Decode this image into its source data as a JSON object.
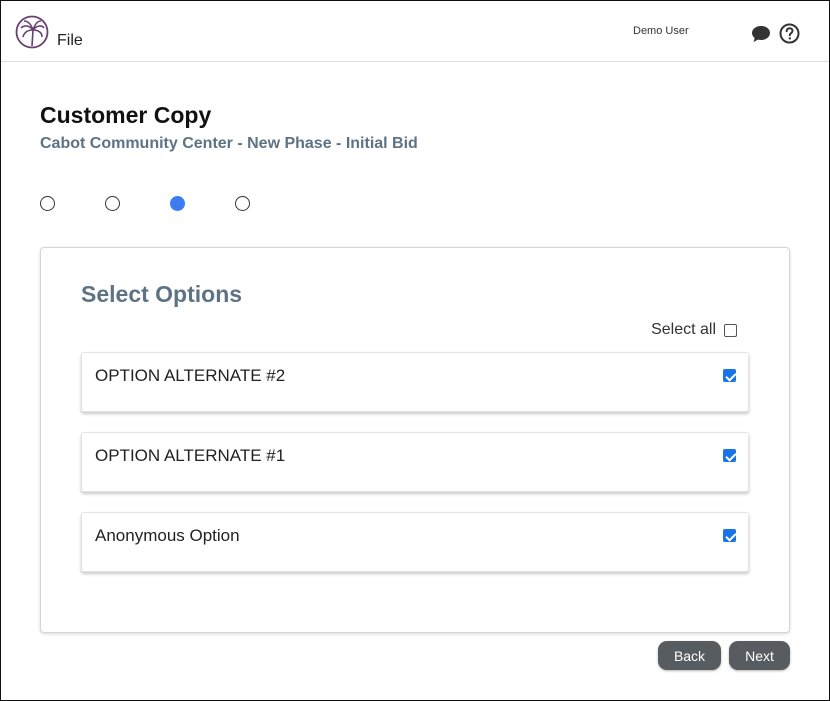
{
  "header": {
    "file_menu": "File",
    "user_name": "Demo User",
    "icons": {
      "logo": "palm-tree-logo",
      "chat": "chat-bubble-icon",
      "help": "help-circle-icon"
    }
  },
  "page": {
    "title": "Customer Copy",
    "subtitle": "Cabot Community Center - New Phase - Initial Bid"
  },
  "steps": {
    "count": 4,
    "active_index": 2
  },
  "options_card": {
    "title": "Select Options",
    "select_all_label": "Select all",
    "select_all_checked": false,
    "options": [
      {
        "label": "OPTION ALTERNATE #2",
        "checked": true
      },
      {
        "label": "OPTION ALTERNATE #1",
        "checked": true
      },
      {
        "label": "Anonymous Option",
        "checked": true
      }
    ]
  },
  "buttons": {
    "back": "Back",
    "next": "Next"
  },
  "colors": {
    "accent": "#3d7cf0",
    "checkbox": "#1a73e8",
    "heading_muted": "#5d7384",
    "button_bg": "#575c61",
    "logo": "#6a3f74"
  }
}
